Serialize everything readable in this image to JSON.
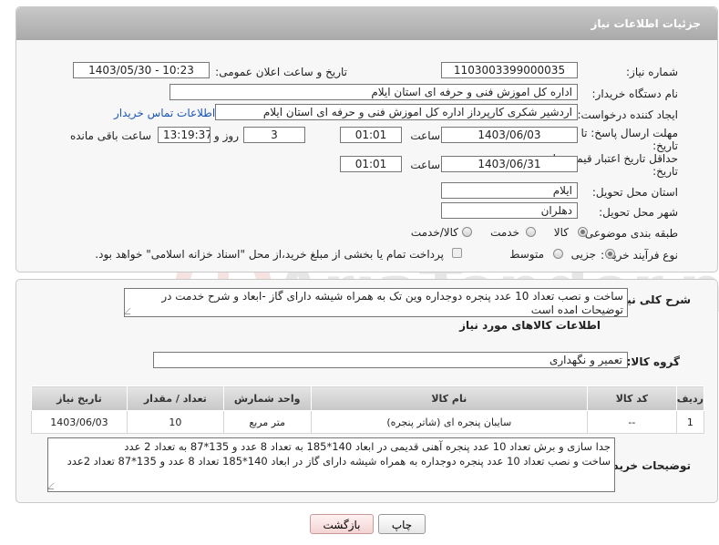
{
  "panel": {
    "title": "جزئیات اطلاعات نیاز"
  },
  "fields": {
    "need_number": {
      "label": "شماره نیاز:",
      "value": "1103003399000035"
    },
    "announce_datetime": {
      "label": "تاریخ و ساعت اعلان عمومی:",
      "value": "1403/05/30 - 10:23"
    },
    "buyer_org": {
      "label": "نام دستگاه خریدار:",
      "value": "اداره کل اموزش فنی و حرفه ای استان ایلام"
    },
    "requester": {
      "label": "ایجاد کننده درخواست:",
      "value": "اردشیر شکری کارپرداز اداره کل اموزش فنی و حرفه ای استان ایلام",
      "contact_link": "اطلاعات تماس خریدار"
    },
    "reply_deadline": {
      "label_line1": "مهلت ارسال پاسخ: تا",
      "label_line2": "تاریخ:",
      "date": "1403/06/03",
      "time_label": "ساعت",
      "time": "01:01",
      "days": "3",
      "days_label": "روز و",
      "remaining": "13:19:37",
      "remaining_label": "ساعت باقی مانده"
    },
    "price_validity": {
      "label_line1": "حداقل تاریخ اعتبار قیمت: تا",
      "label_line2": "تاریخ:",
      "date": "1403/06/31",
      "time_label": "ساعت",
      "time": "01:01"
    },
    "province": {
      "label": "استان محل تحویل:",
      "value": "ایلام"
    },
    "city": {
      "label": "شهر محل تحویل:",
      "value": "دهلران"
    },
    "category": {
      "label": "طبقه بندی موضوعی:",
      "options": [
        "کالا",
        "خدمت",
        "کالا/خدمت"
      ],
      "selected": "کالا"
    },
    "purchase_type": {
      "label": "نوع فرآیند خرید :",
      "options": [
        "جزیی",
        "متوسط"
      ],
      "selected": "جزیی",
      "payment_note": "پرداخت تمام یا بخشی از مبلغ خرید،از محل \"اسناد خزانه اسلامی\" خواهد بود."
    }
  },
  "summary": {
    "label": "شرح کلی نیاز:",
    "text": "ساخت و نصب تعداد 10 عدد پنجره دوجداره وین تک به همراه شیشه دارای گاز -ابعاد و شرح خدمت در توضیحات امده است"
  },
  "goods_info": {
    "title": "اطلاعات کالاهای مورد نیاز",
    "group_label": "گروه کالا:",
    "group_value": "تعمیر و نگهداری"
  },
  "table": {
    "headers": [
      "ردیف",
      "کد کالا",
      "نام کالا",
      "واحد شمارش",
      "تعداد / مقدار",
      "تاریخ نیاز"
    ],
    "rows": [
      [
        "1",
        "--",
        "سایبان پنجره ای (شاتر پنجره)",
        "متر مربع",
        "10",
        "1403/06/03"
      ]
    ]
  },
  "buyer_notes": {
    "label": "توضیحات خریدار:",
    "line1": "جدا سازی و برش تعداد 10 عدد پنجره آهنی قدیمی در ابعاد 140*185 به تعداد 8 عدد و 135*87 به تعداد 2 عدد",
    "line2": "ساخت و نصب تعداد 10 عدد پنجره دوجداره به همراه شیشه دارای گاز در ابعاد 140*185 تعداد 8 عدد و 135*87 تعداد 2عدد"
  },
  "buttons": {
    "print": "چاپ",
    "back": "بازگشت"
  },
  "watermark": {
    "text": "AriaTender.net"
  }
}
